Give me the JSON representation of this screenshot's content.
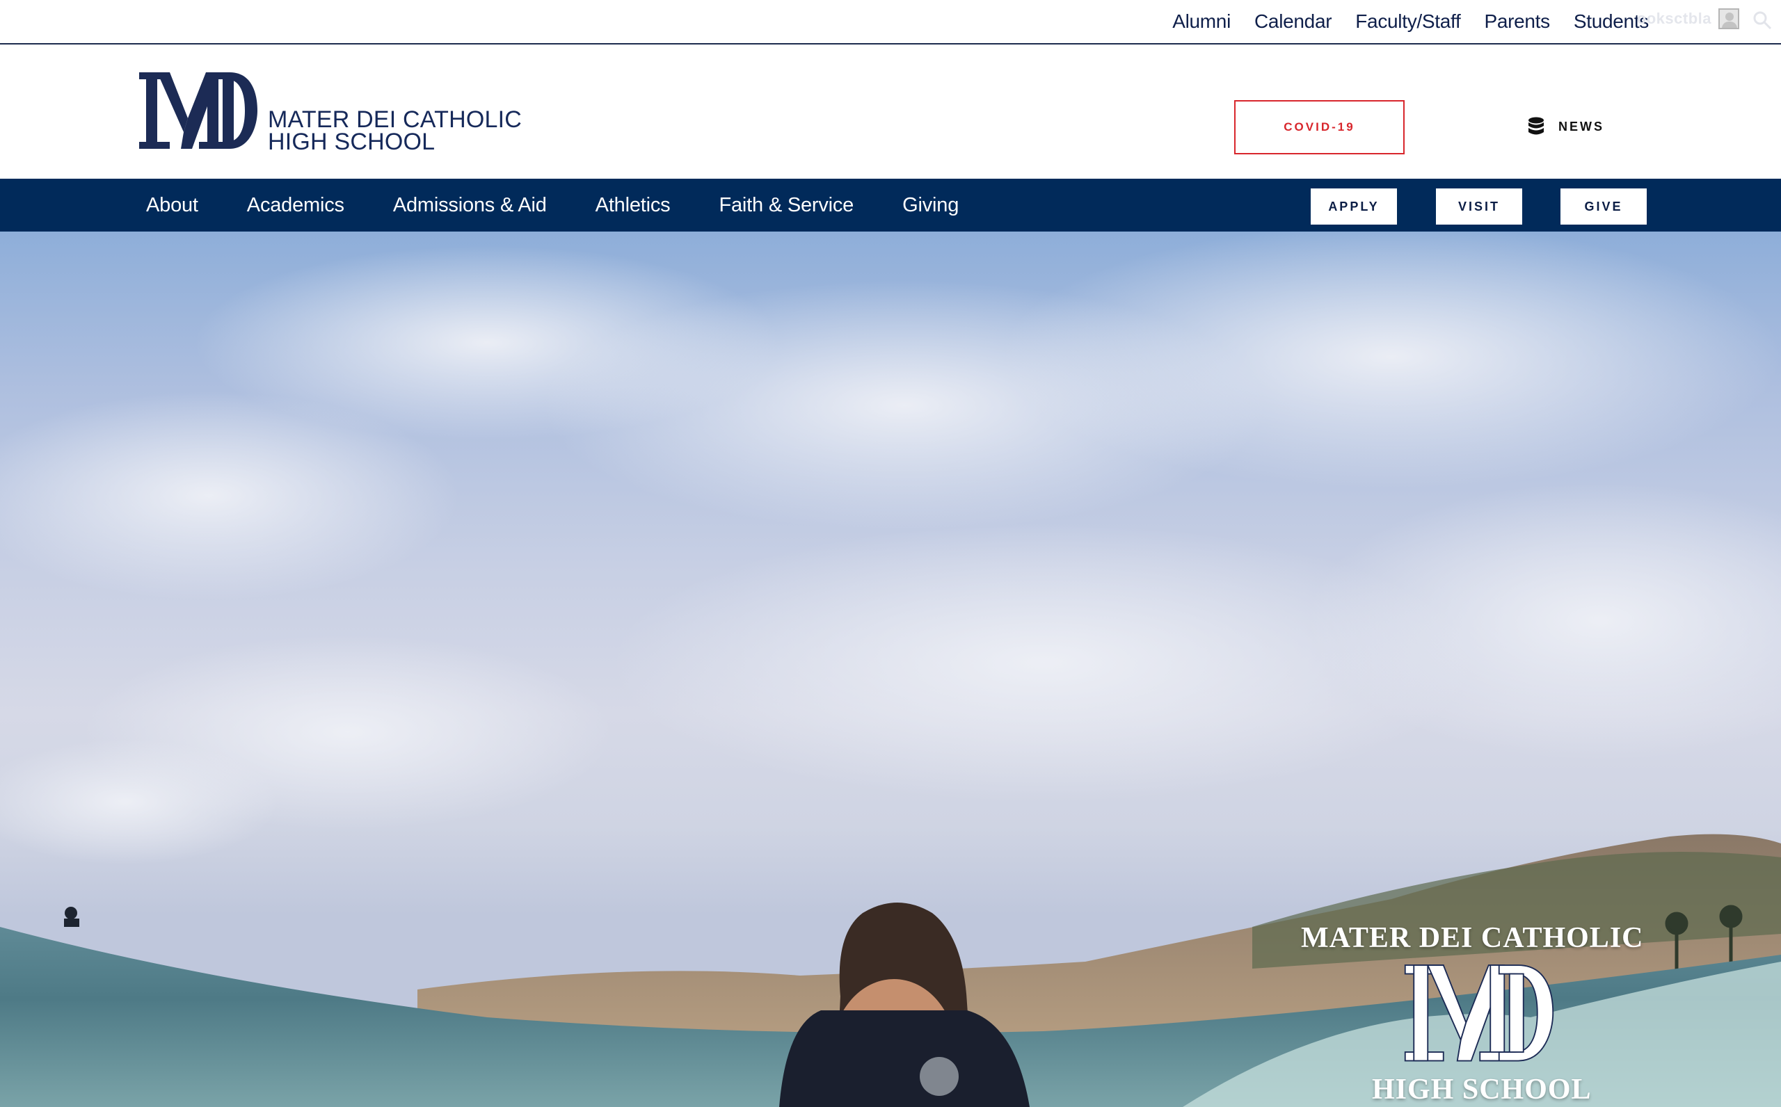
{
  "utility": {
    "links": [
      "Alumni",
      "Calendar",
      "Faculty/Staff",
      "Parents",
      "Students"
    ],
    "user_name": "ooksctbla"
  },
  "brand": {
    "school_line1": "MATER DEI CATHOLIC",
    "school_line2": "HIGH SCHOOL",
    "covid_label": "COVID-19",
    "news_label": "NEWS"
  },
  "nav": {
    "items": [
      "About",
      "Academics",
      "Admissions & Aid",
      "Athletics",
      "Faith & Service",
      "Giving"
    ],
    "apply_label": "APPLY",
    "visit_label": "VISIT",
    "give_label": "GIVE"
  },
  "hero": {
    "overlay_title": "MATER DEI CATHOLIC",
    "overlay_sub": "HIGH SCHOOL"
  },
  "colors": {
    "navy": "#012a5a",
    "logo_navy": "#1c2b55",
    "covid_red": "#d8262c"
  }
}
